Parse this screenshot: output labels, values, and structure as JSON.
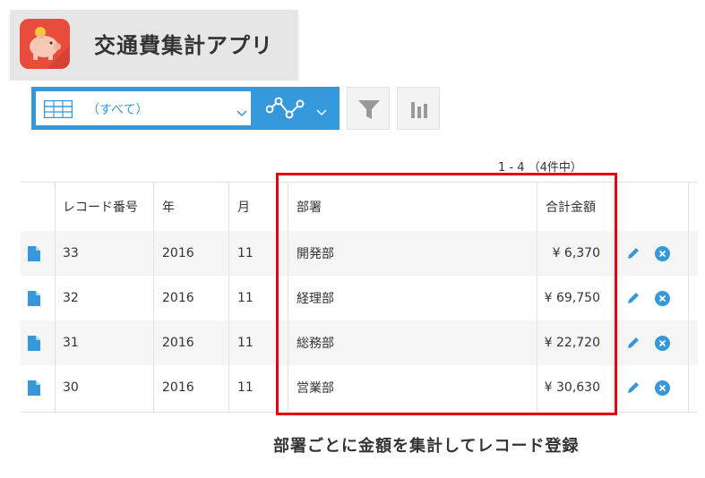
{
  "app": {
    "title": "交通費集計アプリ",
    "icon": "piggy-bank-icon",
    "icon_color": "#e84c3d"
  },
  "toolbar": {
    "view_selected": "（すべて）",
    "view_icon": "table-icon",
    "graph_icon": "line-graph-icon",
    "filter_icon": "funnel-icon",
    "stats_icon": "bar-chart-icon",
    "accent_color": "#3498db"
  },
  "pagination": {
    "text": "1 - 4 （4件中）"
  },
  "table": {
    "headers": [
      "レコード番号",
      "年",
      "月",
      "部署",
      "合計金額"
    ],
    "rows": [
      {
        "record_no": "33",
        "year": "2016",
        "month": "11",
        "department": "開発部",
        "total": "¥ 6,370"
      },
      {
        "record_no": "32",
        "year": "2016",
        "month": "11",
        "department": "経理部",
        "total": "¥ 69,750"
      },
      {
        "record_no": "31",
        "year": "2016",
        "month": "11",
        "department": "総務部",
        "total": "¥ 22,720"
      },
      {
        "record_no": "30",
        "year": "2016",
        "month": "11",
        "department": "営業部",
        "total": "¥ 30,630"
      }
    ]
  },
  "annotation": {
    "caption": "部署ごとに金額を集計してレコード登録",
    "highlight_color": "#e60012"
  }
}
